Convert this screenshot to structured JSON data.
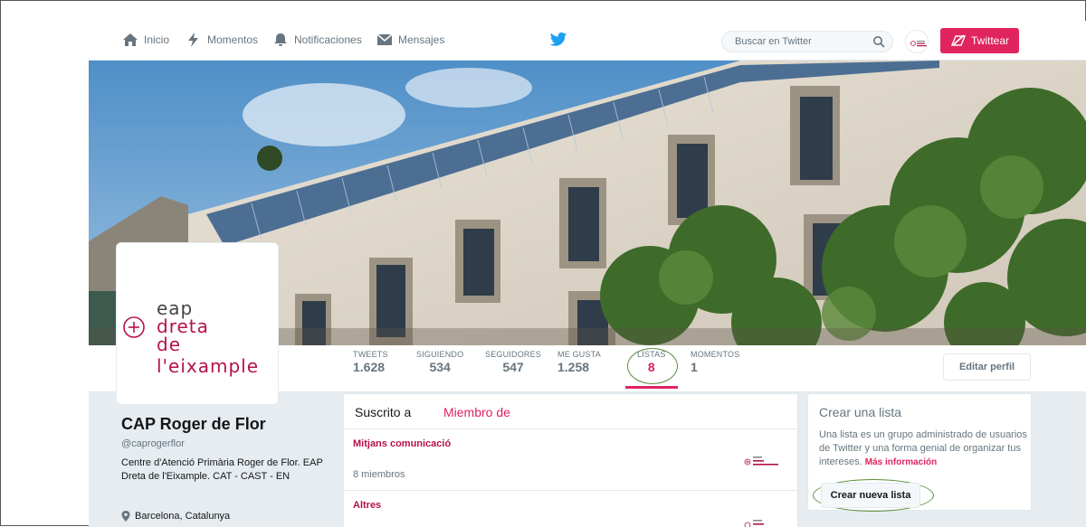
{
  "nav": {
    "home_label": "Inicio",
    "moments_label": "Momentos",
    "notifications_label": "Notificaciones",
    "messages_label": "Mensajes",
    "search_placeholder": "Buscar en Twitter",
    "tweet_label": "Twittear"
  },
  "brand": {
    "accent": "#e0245e",
    "twitter_blue": "#1da1f2",
    "highlight_circle": "#5a8f3a"
  },
  "logo": {
    "line1": "eap",
    "line2": "dreta",
    "line3": "de l'eixample"
  },
  "stats": [
    {
      "label": "TWEETS",
      "value": "1.628"
    },
    {
      "label": "SIGUIENDO",
      "value": "534"
    },
    {
      "label": "SEGUIDORES",
      "value": "547"
    },
    {
      "label": "ME GUSTA",
      "value": "1.258"
    },
    {
      "label": "LISTAS",
      "value": "8",
      "active": true
    },
    {
      "label": "MOMENTOS",
      "value": "1"
    }
  ],
  "edit_profile_label": "Editar perfil",
  "profile": {
    "name": "CAP Roger de Flor",
    "handle": "@caprogerflor",
    "bio": "Centre d'Atenció Primària Roger de Flor. EAP Dreta de l'Eixample. CAT - CAST - EN",
    "location": "Barcelona, Catalunya"
  },
  "lists": {
    "tab_subscribed": "Suscrito a",
    "tab_member": "Miembro de",
    "items": [
      {
        "name": "Mitjans comunicació",
        "members": "8 miembros"
      },
      {
        "name": "Altres",
        "members": ""
      }
    ],
    "mini_logo": {
      "l1": "eap",
      "l2": "dreta",
      "l3": "de l'eixample"
    }
  },
  "create_list": {
    "title": "Crear una lista",
    "description": "Una lista es un grupo administrado de usuarios de Twitter y una forma genial de organizar tus intereses.",
    "more_link": "Más información",
    "button_label": "Crear nueva lista"
  }
}
